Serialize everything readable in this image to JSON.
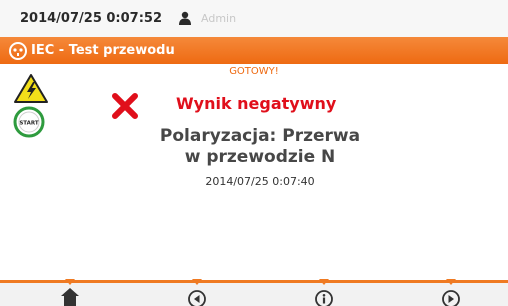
{
  "status_bar": {
    "datetime": "2014/07/25 0:07:52",
    "user": "Admin",
    "user_icon": "user-icon"
  },
  "title_bar": {
    "title": "IEC - Test przewodu",
    "icon": "plug-icon"
  },
  "main": {
    "state": "GOTOWY!",
    "result": "Wynik negatywny",
    "message_line1": "Polaryzacja: Przerwa",
    "message_line2": "w przewodzie N",
    "timestamp": "2014/07/25 0:07:40",
    "start_label": "START",
    "icons": [
      "high-voltage-warning-icon",
      "start-icon",
      "fail-cross-icon"
    ]
  },
  "bottom_nav": {
    "buttons": [
      "home-icon",
      "back-icon",
      "info-icon",
      "forward-icon"
    ]
  },
  "colors": {
    "accent": "#ee6a12",
    "fail": "#e00f1b",
    "start_ring": "#2e9b3e",
    "warning": "#f2df1a"
  }
}
